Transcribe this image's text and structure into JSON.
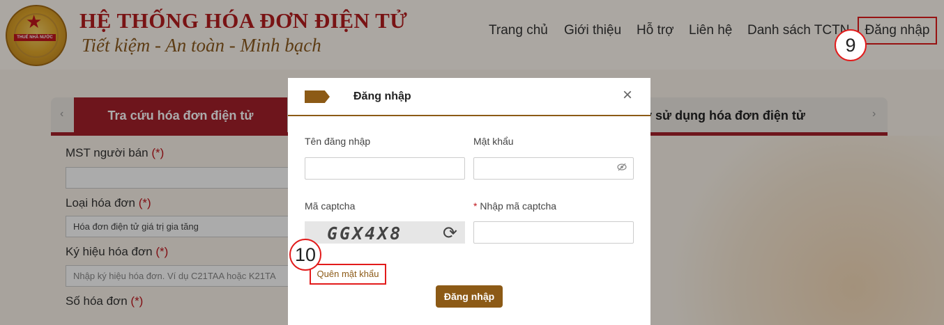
{
  "header": {
    "emblem_text": "THUẾ NHÀ NƯỚC",
    "title": "HỆ THỐNG HÓA ĐƠN ĐIỆN TỬ",
    "slogan": "Tiết kiệm - An toàn - Minh bạch",
    "nav": [
      "Trang chủ",
      "Giới thiệu",
      "Hỗ trợ",
      "Liên hệ",
      "Danh sách TCTN",
      "Đăng nhập"
    ]
  },
  "callouts": {
    "login_nav": "9",
    "forgot_link": "10"
  },
  "tabs": {
    "left_arrow": "‹",
    "right_arrow": "›",
    "active": "Tra cứu hóa đơn điện tử",
    "partial": "ký sử dụng hóa đơn điện tử"
  },
  "form": {
    "seller_tax_label": "MST người bán",
    "invoice_type_label": "Loại hóa đơn",
    "invoice_type_value": "Hóa đơn điện tử giá trị gia tăng",
    "symbol_label": "Ký hiệu hóa đơn",
    "symbol_placeholder": "Nhập ký hiệu hóa đơn. Ví dụ C21TAA hoặc K21TA",
    "number_label": "Số hóa đơn",
    "required_mark": "(*)"
  },
  "modal": {
    "title": "Đăng nhập",
    "close": "×",
    "username_label": "Tên đăng nhập",
    "password_label": "Mật khẩu",
    "captcha_label": "Mã captcha",
    "captcha_required": "*",
    "captcha_input_label": "Nhập mã captcha",
    "captcha_text": "GGX4X8",
    "forgot_password": "Quên mật khẩu",
    "submit": "Đăng nhập"
  },
  "colors": {
    "brand_red": "#a4202a",
    "brand_brown": "#8c5a16",
    "callout_red": "#e21b1b"
  },
  "icons": [
    "emblem-icon",
    "close-icon",
    "eye-slash-icon",
    "refresh-icon",
    "arrow-tag-icon"
  ]
}
